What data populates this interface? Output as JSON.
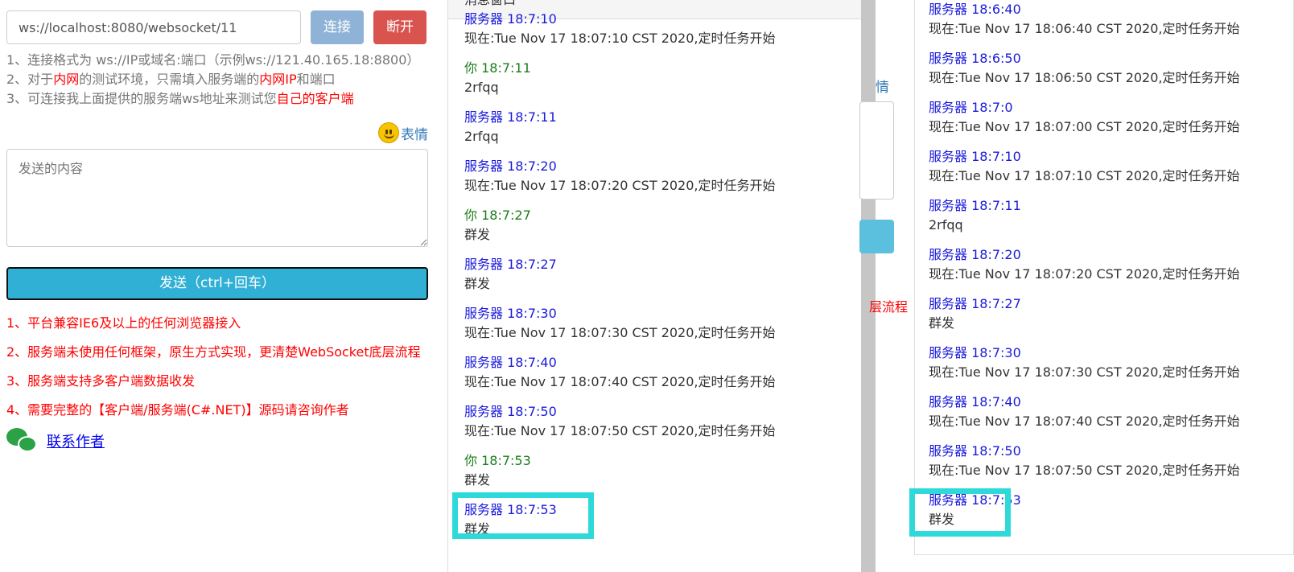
{
  "left": {
    "url_value": "ws://localhost:8080/websocket/11",
    "connect_label": "连接",
    "disconnect_label": "断开",
    "tips": {
      "t1": "1、连接格式为 ws://IP或域名:端口（示例ws://121.40.165.18:8800）",
      "t2a": "2、对于",
      "t2b": "内网",
      "t2c": "的测试环境，只需填入服务端的",
      "t2d": "内网IP",
      "t2e": "和端口",
      "t3a": "3、可连接我上面提供的服务端ws地址来测试您",
      "t3b": "自己的客户端"
    },
    "emoji_label": "表情",
    "content_placeholder": "发送的内容",
    "send_label": "发送（ctrl+回车）",
    "features": [
      "1、平台兼容IE6及以上的任何浏览器接入",
      "2、服务端未使用任何框架，原生方式实现，更清楚WebSocket底层流程",
      "3、服务端支持多客户端数据收发",
      "4、需要完整的【客户端/服务端(C#.NET)】源码请咨询作者"
    ],
    "contact_label": "联系作者"
  },
  "middle": {
    "header_title": "消息窗口",
    "messages": [
      {
        "who": "服务器 18:7:10",
        "type": "server",
        "text": "现在:Tue Nov 17 18:07:10 CST 2020,定时任务开始"
      },
      {
        "who": "你 18:7:11",
        "type": "you",
        "text": "2rfqq"
      },
      {
        "who": "服务器 18:7:11",
        "type": "server",
        "text": "2rfqq"
      },
      {
        "who": "服务器 18:7:20",
        "type": "server",
        "text": "现在:Tue Nov 17 18:07:20 CST 2020,定时任务开始"
      },
      {
        "who": "你 18:7:27",
        "type": "you",
        "text": "群发"
      },
      {
        "who": "服务器 18:7:27",
        "type": "server",
        "text": "群发"
      },
      {
        "who": "服务器 18:7:30",
        "type": "server",
        "text": "现在:Tue Nov 17 18:07:30 CST 2020,定时任务开始"
      },
      {
        "who": "服务器 18:7:40",
        "type": "server",
        "text": "现在:Tue Nov 17 18:07:40 CST 2020,定时任务开始"
      },
      {
        "who": "服务器 18:7:50",
        "type": "server",
        "text": "现在:Tue Nov 17 18:07:50 CST 2020,定时任务开始"
      },
      {
        "who": "你 18:7:53",
        "type": "you",
        "text": "群发"
      },
      {
        "who": "服务器 18:7:53",
        "type": "server",
        "text": "群发"
      }
    ]
  },
  "right": {
    "emoji_fragment": "情",
    "flow_fragment": "层流程",
    "messages": [
      {
        "who": "服务器 18:6:40",
        "type": "server",
        "text": "现在:Tue Nov 17 18:06:40 CST 2020,定时任务开始"
      },
      {
        "who": "服务器 18:6:50",
        "type": "server",
        "text": "现在:Tue Nov 17 18:06:50 CST 2020,定时任务开始"
      },
      {
        "who": "服务器 18:7:0",
        "type": "server",
        "text": "现在:Tue Nov 17 18:07:00 CST 2020,定时任务开始"
      },
      {
        "who": "服务器 18:7:10",
        "type": "server",
        "text": "现在:Tue Nov 17 18:07:10 CST 2020,定时任务开始"
      },
      {
        "who": "服务器 18:7:11",
        "type": "server",
        "text": "2rfqq"
      },
      {
        "who": "服务器 18:7:20",
        "type": "server",
        "text": "现在:Tue Nov 17 18:07:20 CST 2020,定时任务开始"
      },
      {
        "who": "服务器 18:7:27",
        "type": "server",
        "text": "群发"
      },
      {
        "who": "服务器 18:7:30",
        "type": "server",
        "text": "现在:Tue Nov 17 18:07:30 CST 2020,定时任务开始"
      },
      {
        "who": "服务器 18:7:40",
        "type": "server",
        "text": "现在:Tue Nov 17 18:07:40 CST 2020,定时任务开始"
      },
      {
        "who": "服务器 18:7:50",
        "type": "server",
        "text": "现在:Tue Nov 17 18:07:50 CST 2020,定时任务开始"
      },
      {
        "who": "服务器 18:7:53",
        "type": "server",
        "text": "群发"
      }
    ]
  },
  "colors": {
    "server_name": "#1a1adb",
    "you_name": "#1a7d1a",
    "highlight": "#2dd9d9",
    "send_button": "#31b0d5",
    "disconnect_button": "#d9534f"
  }
}
